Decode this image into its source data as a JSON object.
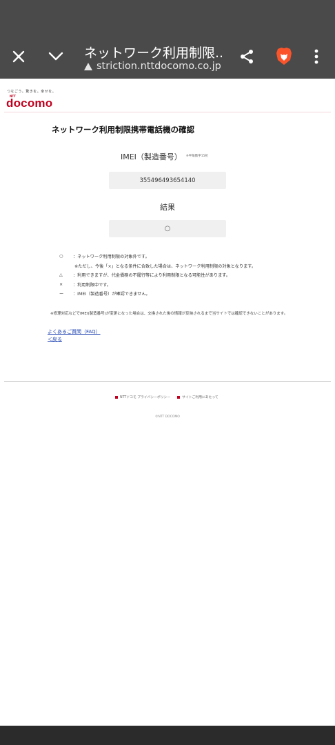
{
  "browser": {
    "title": "ネットワーク利用制限...",
    "url": "striction.nttdocomo.co.jp",
    "icons": [
      "close-icon",
      "chevron-down-icon",
      "warning-icon",
      "share-icon",
      "brave-lion-icon",
      "more-vert-icon"
    ]
  },
  "header": {
    "tagline": "つなごう。驚きを。幸せを。",
    "logo_ntt": "NTT",
    "logo": "docomo"
  },
  "main": {
    "title": "ネットワーク利用制限携帯電話機の確認",
    "imei_label": "IMEI（製造番号）",
    "imei_note": "※半角数字15桁",
    "imei_value": "355496493654140",
    "result_label": "結果",
    "result_value": "○"
  },
  "legend": [
    {
      "symbol": "○",
      "text": "：ネットワーク利用制限の対象外です。"
    },
    {
      "symbol": "",
      "text": "※ただし、今後「×」となる条件に合致した場合は、ネットワーク利用制限の対象となります。"
    },
    {
      "symbol": "△",
      "text": "：利用できますが、代金債務の不履行等により利用制限となる可能性があります。"
    },
    {
      "symbol": "×",
      "text": "：利用制限中です。"
    },
    {
      "symbol": "ー",
      "text": "：IMEI（製造番号）が確認できません。"
    }
  ],
  "note": "※修理対応などでIMEI(製造番号)が変更になった場合は、交換された後の情報が反映されるまで当サイトでは確認できないことがあります。",
  "links": {
    "faq": "よくあるご質問（FAQ）",
    "back": "＜戻る"
  },
  "footer": {
    "privacy": "NTTドコモ プライバシーポリシー",
    "site_terms": "サイトご利用にあたって",
    "copyright": "©NTT DOCOMO"
  },
  "colors": {
    "brand": "#c0001e",
    "chrome": "#4a4a4a",
    "link": "#1a3fae"
  }
}
